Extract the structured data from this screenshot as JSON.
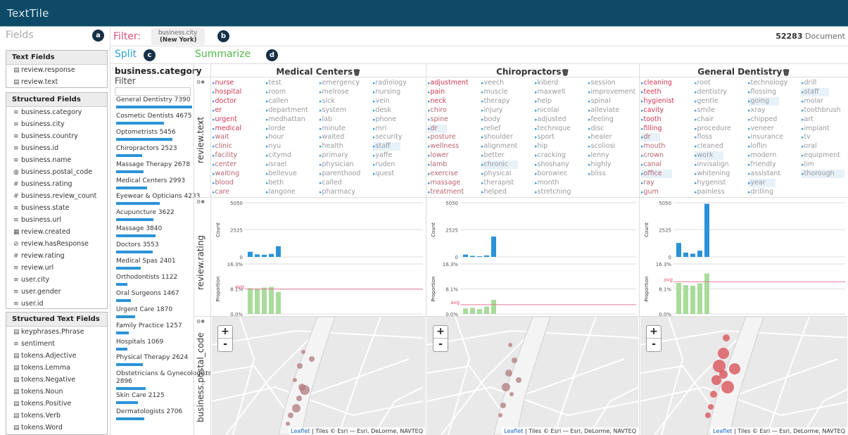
{
  "app": {
    "title": "TextTile"
  },
  "badges": {
    "a": "a",
    "b": "b",
    "c": "c",
    "d": "d"
  },
  "fields_panel": {
    "title": "Fields",
    "text_fields": {
      "header": "Text Fields",
      "items": [
        {
          "icon": "document-icon",
          "label": "review.response"
        },
        {
          "icon": "document-icon",
          "label": "review.text"
        }
      ]
    },
    "structured_fields": {
      "header": "Structured Fields",
      "items": [
        {
          "icon": "list-icon",
          "label": "business.category"
        },
        {
          "icon": "list-icon",
          "label": "business.city"
        },
        {
          "icon": "list-icon",
          "label": "business.country"
        },
        {
          "icon": "list-icon",
          "label": "business.id"
        },
        {
          "icon": "list-icon",
          "label": "business.name"
        },
        {
          "icon": "globe-icon",
          "label": "business.postal_code"
        },
        {
          "icon": "hash-icon",
          "label": "business.rating"
        },
        {
          "icon": "hash-icon",
          "label": "business.review_count"
        },
        {
          "icon": "list-icon",
          "label": "business.state"
        },
        {
          "icon": "list-icon",
          "label": "business.url"
        },
        {
          "icon": "calendar-icon",
          "label": "review.created"
        },
        {
          "icon": "check-circle-icon",
          "label": "review.hasResponse"
        },
        {
          "icon": "hash-icon",
          "label": "review.rating"
        },
        {
          "icon": "list-icon",
          "label": "review.url"
        },
        {
          "icon": "list-icon",
          "label": "user.city"
        },
        {
          "icon": "list-icon",
          "label": "user.gender"
        },
        {
          "icon": "list-icon",
          "label": "user.id"
        }
      ]
    },
    "structured_text_fields": {
      "header": "Structured Text Fields",
      "items": [
        {
          "icon": "document-icon",
          "label": "keyphrases.Phrase"
        },
        {
          "icon": "list-icon",
          "label": "sentiment"
        },
        {
          "icon": "document-icon",
          "label": "tokens.Adjective"
        },
        {
          "icon": "document-icon",
          "label": "tokens.Lemma"
        },
        {
          "icon": "document-icon",
          "label": "tokens.Negative"
        },
        {
          "icon": "document-icon",
          "label": "tokens.Noun"
        },
        {
          "icon": "document-icon",
          "label": "tokens.Positive"
        },
        {
          "icon": "document-icon",
          "label": "tokens.Verb"
        },
        {
          "icon": "document-icon",
          "label": "tokens.Word"
        }
      ]
    }
  },
  "filter": {
    "label": "Filter:",
    "chip_key": "business.city",
    "chip_value": "(New York)",
    "doc_count": "52283",
    "doc_label": "Document"
  },
  "split": {
    "label": "Split",
    "field": "business.category",
    "filter_label": "Filter",
    "max_value": 7390,
    "categories": [
      {
        "name": "General Dentistry",
        "count": 7390
      },
      {
        "name": "Cosmetic Dentists",
        "count": 4675
      },
      {
        "name": "Optometrists",
        "count": 5456
      },
      {
        "name": "Chiropractors",
        "count": 2523
      },
      {
        "name": "Massage Therapy",
        "count": 2678
      },
      {
        "name": "Medical Centers",
        "count": 2993
      },
      {
        "name": "Eyewear & Opticians",
        "count": 4233
      },
      {
        "name": "Acupuncture",
        "count": 3622
      },
      {
        "name": "Massage",
        "count": 3840
      },
      {
        "name": "Doctors",
        "count": 3553
      },
      {
        "name": "Medical Spas",
        "count": 2401
      },
      {
        "name": "Orthodontists",
        "count": 1122
      },
      {
        "name": "Oral Surgeons",
        "count": 1467
      },
      {
        "name": "Urgent Care",
        "count": 1870
      },
      {
        "name": "Family Practice",
        "count": 1257
      },
      {
        "name": "Hospitals",
        "count": 1069
      },
      {
        "name": "Physical Therapy",
        "count": 2624
      },
      {
        "name": "Obstetricians & Gynecologists",
        "count": 2896
      },
      {
        "name": "Skin Care",
        "count": 2125
      },
      {
        "name": "Dermatologists",
        "count": 2706
      }
    ]
  },
  "summarize": {
    "label": "Summarize",
    "rows": [
      "review.text",
      "review.rating",
      "business.postal_code"
    ]
  },
  "columns": [
    {
      "title": "Medical Centers",
      "terms": [
        [
          "nurse",
          "hospital",
          "doctor",
          "er",
          "urgent",
          "medical",
          "wait",
          "clinic",
          "facility",
          "center",
          "waiting",
          "blood",
          "care"
        ],
        [
          "test",
          "room",
          "callen",
          "department",
          "medhattan",
          "lorde",
          "hour",
          "nyu",
          "citymd",
          "israel",
          "bellevue",
          "beth",
          "langone"
        ],
        [
          "emergency",
          "melrose",
          "sick",
          "system",
          "lab",
          "minute",
          "waited",
          "health",
          "primary",
          "physician",
          "parenthood",
          "called",
          "pharmacy"
        ],
        [
          "radiology",
          "nursing",
          "vein",
          "desk",
          "phone",
          "mri",
          "security",
          "staff",
          "yaffe",
          "ruden",
          "quest"
        ]
      ]
    },
    {
      "title": "Chiropractors",
      "terms": [
        [
          "adjustment",
          "pain",
          "neck",
          "chiro",
          "spine",
          "dr",
          "posture",
          "wellness",
          "lower",
          "lamb",
          "exercise",
          "massage",
          "treatment"
        ],
        [
          "veech",
          "muscle",
          "therapy",
          "injury",
          "body",
          "relief",
          "shoulder",
          "alignment",
          "better",
          "chronic",
          "physical",
          "therapist",
          "helped"
        ],
        [
          "kiberd",
          "maxwell",
          "help",
          "nicolai",
          "adjusted",
          "technique",
          "sport",
          "hip",
          "cracking",
          "shoshany",
          "borowiec",
          "month",
          "stretching"
        ],
        [
          "session",
          "improvement",
          "spinal",
          "alleviate",
          "feeling",
          "disc",
          "healer",
          "scoliosi",
          "lenny",
          "highly",
          "bliss"
        ]
      ]
    },
    {
      "title": "General Dentistry",
      "terms": [
        [
          "cleaning",
          "teeth",
          "hygienist",
          "cavity",
          "tooth",
          "filling",
          "dr",
          "mouth",
          "crown",
          "canal",
          "office",
          "ray",
          "gum"
        ],
        [
          "root",
          "dentistry",
          "gentle",
          "smile",
          "chair",
          "procedure",
          "floss",
          "cleaned",
          "work",
          "invisalign",
          "whitening",
          "hygenist",
          "painless"
        ],
        [
          "technology",
          "flossing",
          "going",
          "xray",
          "chipped",
          "veneer",
          "insurance",
          "loflin",
          "modern",
          "friendly",
          "assistant",
          "year",
          "drilling"
        ],
        [
          "drill",
          "staff",
          "molar",
          "toothbrush",
          "art",
          "implant",
          "tv",
          "oral",
          "equipment",
          "lim",
          "thorough"
        ]
      ]
    }
  ],
  "chart_data": [
    {
      "type": "bar",
      "title": "Medical Centers",
      "ylabel": "Count",
      "ylim": [
        0,
        5050
      ],
      "ytick_labels": [
        "0",
        "2525",
        "5050"
      ],
      "values": [
        480,
        240,
        200,
        280,
        1000
      ]
    },
    {
      "type": "bar",
      "title": "Medical Centers",
      "ylabel": "Proportion",
      "ylim": [
        0,
        16.3
      ],
      "ytick_labels": [
        "0.0%",
        "8.1%",
        "16.3%"
      ],
      "avg_label": "avg",
      "avg": 8.1,
      "values": [
        8.4,
        8.3,
        8.6,
        8.8,
        7.2
      ]
    },
    {
      "type": "bar",
      "title": "Chiropractors",
      "ylabel": "Count",
      "ylim": [
        0,
        5050
      ],
      "ytick_labels": [
        "0",
        "2525",
        "5050"
      ],
      "values": [
        220,
        100,
        60,
        140,
        1900
      ]
    },
    {
      "type": "bar",
      "title": "Chiropractors",
      "ylabel": "Proportion",
      "ylim": [
        0,
        16.3
      ],
      "ytick_labels": [
        "0.0%",
        "8.1%",
        "16.3%"
      ],
      "avg_label": "avg",
      "avg": 3.0,
      "values": [
        1.8,
        2.0,
        1.6,
        2.4,
        4.6
      ]
    },
    {
      "type": "bar",
      "title": "General Dentistry",
      "ylabel": "Count",
      "ylim": [
        0,
        5050
      ],
      "ytick_labels": [
        "0",
        "2525",
        "5050"
      ],
      "values": [
        1300,
        400,
        300,
        580,
        4950
      ]
    },
    {
      "type": "bar",
      "title": "General Dentistry",
      "ylabel": "Proportion",
      "ylim": [
        0,
        16.3
      ],
      "ytick_labels": [
        "0.0%",
        "8.1%",
        "16.3%"
      ],
      "avg_label": "avg",
      "avg": 10.5,
      "values": [
        10.1,
        9.4,
        9.2,
        10.0,
        13.2
      ]
    }
  ],
  "map": {
    "attribution_link": "Leaflet",
    "attribution_text": " | Tiles © Esri — Esri, DeLorme, NAVTEQ",
    "zoom_in": "+",
    "zoom_out": "-"
  },
  "colors": {
    "header": "#0d4a68",
    "filter": "#e0507a",
    "split": "#2d9fd8",
    "summarize": "#52b848",
    "count_bar": "#2b92d9",
    "proportion_bar": "#a8dc9a",
    "term_primary": "#d0344f",
    "term_secondary": "#c8858f"
  }
}
